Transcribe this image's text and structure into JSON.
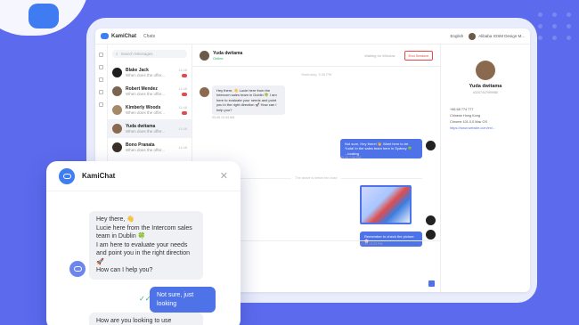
{
  "app": {
    "brand": "KamiChat",
    "section": "Chats"
  },
  "topbar": {
    "language": "English",
    "account": "Alibaba IOSM Design M..."
  },
  "search": {
    "placeholder": "Search Messages"
  },
  "chats": [
    {
      "name": "Blake Jack",
      "preview": "When does the offer...",
      "time": "11:48",
      "badge": true
    },
    {
      "name": "Robert Mendez",
      "preview": "When does the offer...",
      "time": "11:48",
      "badge": true
    },
    {
      "name": "Kimberly Woods",
      "preview": "When does the offer...",
      "time": "11:48",
      "badge": true
    },
    {
      "name": "Yuda dwitama",
      "preview": "When does the offer...",
      "time": "11:48",
      "badge": false
    },
    {
      "name": "Bono Pranata",
      "preview": "When does the offer...",
      "time": "11:48",
      "badge": false
    }
  ],
  "conversation": {
    "name": "Yuda dwitama",
    "status": "Online",
    "waiting": "Waiting for Window",
    "end_label": "End Session",
    "day": "Yesterday, 3:45 PM",
    "in1": "Hey there, 👋 Lucie here from the Intercom sales team in Dublin 🍀 I am here to evaluate your needs and point you in the right direction 🚀 How can I help you?",
    "in1_time": "03:45 12:34 AM",
    "out1": "Not sure, Hey there! 👋 Want here to be Yuda! In the sales team here in Sydney 🍀 ...looking",
    "out1_time": "03:45 7:06 PM",
    "separator": "The above is before the close",
    "out2": "Remember to check the picture 🌸",
    "out2_time": "17:45 13:30 PM"
  },
  "profile": {
    "name": "Yuda dwitama",
    "id": "#3207447999986",
    "phone": "+86 68 774 777",
    "region": "Chinese Hong Kong",
    "browser": "Chrome 101.0.0 Mac OS",
    "url": "https://www.website.com/en/..."
  },
  "widget": {
    "title": "KamiChat",
    "in1": [
      "Hey there, 👋",
      "Lucie here from the Intercom sales",
      "team in Dublin 🍀",
      "I am here to evaluate your needs",
      "and point you in the right direction",
      "🚀",
      "How can I help you?"
    ],
    "out1": "Not sure, just looking",
    "in2": "How are you looking to use"
  },
  "colors": {
    "accent": "#4e72e8",
    "background": "#5c6bee",
    "danger": "#e24b4b"
  }
}
